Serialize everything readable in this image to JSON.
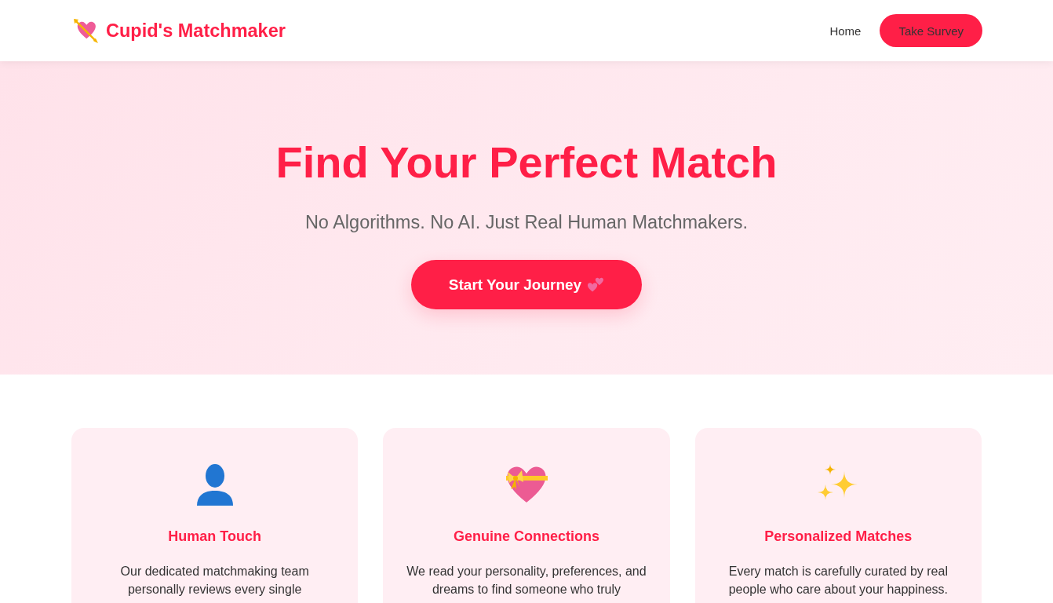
{
  "header": {
    "logo": {
      "text": "Cupid's Matchmaker"
    },
    "nav": [
      {
        "label": "Home",
        "kind": "link"
      },
      {
        "label": "Take Survey",
        "kind": "button"
      }
    ]
  },
  "hero": {
    "title": "Find Your Perfect Match",
    "subtitle": "No Algorithms. No AI. Just Real Human Matchmakers.",
    "button": "Start Your Journey"
  },
  "features": [
    {
      "title": "Human Touch",
      "description": "Our dedicated matchmaking team personally reviews every single"
    },
    {
      "title": "Genuine Connections",
      "description": "We read your personality, preferences, and dreams to find someone who truly"
    },
    {
      "title": "Personalized Matches",
      "description": "Every match is carefully curated by real people who care about your happiness."
    }
  ]
}
